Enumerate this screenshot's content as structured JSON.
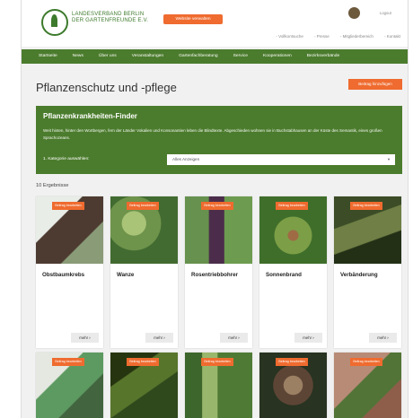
{
  "header": {
    "logo_lines": [
      "LANDESVERBAND BERLIN",
      "DER GARTENFREUNDE E.V."
    ],
    "website_button": "Website verwalten",
    "logout": "Logout",
    "top_links": [
      "Vollkontsuche",
      "Presse",
      "Mitgliederbereich",
      "Kontakt"
    ]
  },
  "navigation": [
    "Startseite",
    "News",
    "Über uns",
    "Veranstaltungen",
    "Gartenfachberatung",
    "Service",
    "Kooperationen",
    "Bezirksverbände"
  ],
  "page": {
    "title": "Pflanzenschutz und -pflege",
    "add_button": "Beitrag hinzufügen"
  },
  "finder": {
    "title": "Pflanzenkrankheiten-Finder",
    "text": "Weit hinten, hinter den Wortbergen, fern der Länder Vokalien und Konsonantien leben die Blindtexte. Abgeschieden wohnen sie in Buchstabhausen an der Küste des Semantik, eines großen Sprachozeans.",
    "category_label": "1. Kategorie auswählen:",
    "selected": "Alles Anzeigen"
  },
  "results_count": "10 Ergebnisse",
  "card_action": "Beitrag bearbeiten",
  "more_label": "mehr",
  "cards": [
    "Obstbaumkrebs",
    "Wanze",
    "Rosentriebbohrer",
    "Sonnenbrand",
    "Verbänderung"
  ],
  "colors": {
    "green": "#4b7c2d",
    "orange": "#ef6b2f"
  }
}
